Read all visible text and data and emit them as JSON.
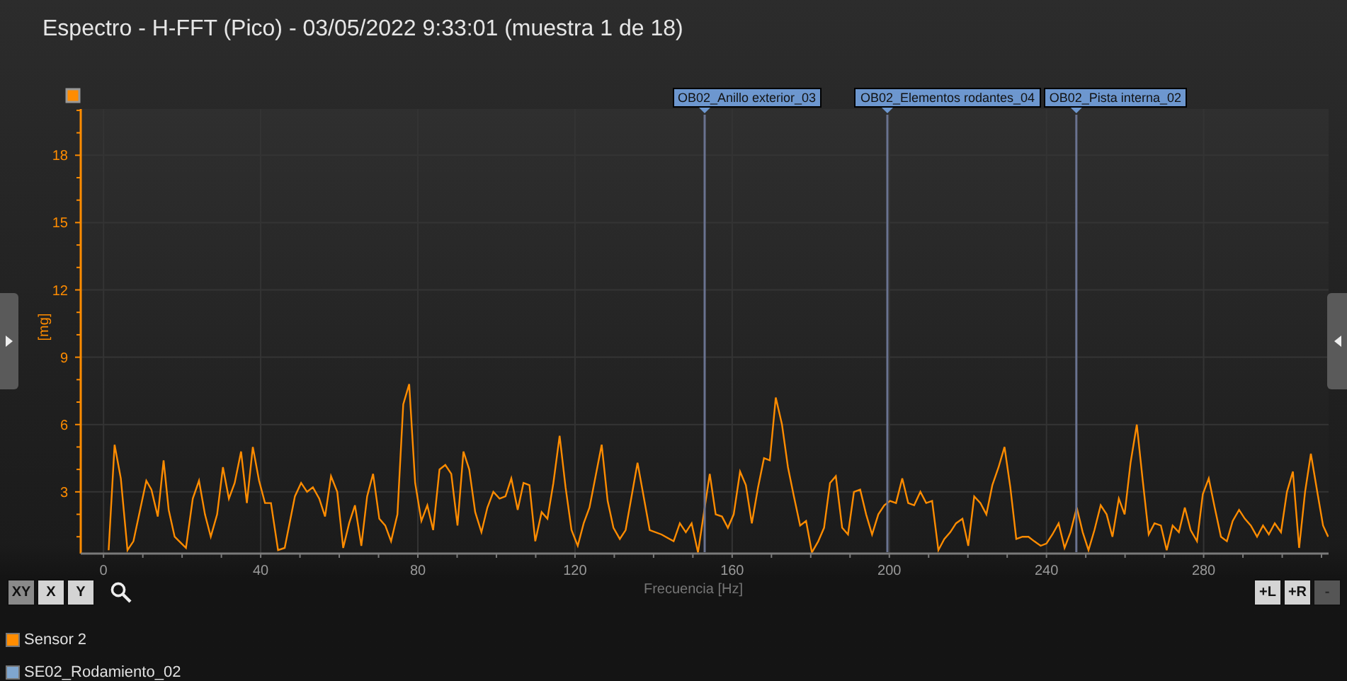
{
  "title": "Espectro - H-FFT (Pico) - 03/05/2022 9:33:01 (muestra 1 de 18)",
  "chart": {
    "chart_data": {
      "type": "line",
      "xlabel": "Frecuencia [Hz]",
      "ylabel": "[mg]",
      "grid": true,
      "xlim": [
        -5.8,
        311.8
      ],
      "ylim": [
        0.25,
        20.06
      ],
      "xticks": [
        0,
        40,
        80,
        120,
        160,
        200,
        240,
        280
      ],
      "yticks": [
        3,
        6,
        9,
        12,
        15,
        18
      ],
      "x": [
        1.3,
        2.8,
        4.4,
        6.1,
        7.6,
        10.9,
        12.2,
        13.8,
        15.3,
        16.6,
        18.1,
        21,
        22.7,
        24.3,
        25.8,
        27.3,
        28.9,
        30.4,
        31.9,
        33.4,
        35,
        36.5,
        38,
        39.6,
        41.1,
        42.6,
        44.4,
        46.1,
        48.7,
        50.3,
        51.8,
        53.3,
        54.9,
        56.4,
        57.9,
        59.5,
        61,
        62.5,
        64,
        65.6,
        67.1,
        68.6,
        70.2,
        71.7,
        73.2,
        74.8,
        76.3,
        77.8,
        79.3,
        80.9,
        82.4,
        83.9,
        85.5,
        87,
        88.5,
        90.1,
        91.6,
        93.1,
        94.6,
        96.2,
        97.7,
        99.2,
        100.8,
        102.3,
        103.8,
        105.4,
        106.9,
        108.4,
        109.9,
        111.5,
        113,
        114.5,
        116.1,
        117.6,
        119.1,
        120.7,
        122.2,
        123.7,
        126.8,
        128.3,
        129.8,
        131.4,
        132.9,
        135.9,
        139,
        142,
        145.1,
        146.7,
        148.2,
        149.7,
        151.3,
        154.3,
        155.8,
        157.4,
        158.9,
        160.4,
        162,
        163.5,
        165,
        166.6,
        168.1,
        169.6,
        171.1,
        172.7,
        174.2,
        175.7,
        177.3,
        178.8,
        180.3,
        181.9,
        183.4,
        184.9,
        186.4,
        188,
        189.5,
        191,
        192.6,
        194.1,
        195.6,
        197.2,
        198.7,
        200.2,
        201.7,
        203.3,
        204.8,
        206.3,
        207.9,
        209.4,
        210.9,
        212.5,
        214,
        215.5,
        217,
        218.6,
        220.1,
        221.6,
        223.2,
        224.7,
        226.2,
        227.8,
        229.3,
        230.8,
        232.3,
        233.9,
        235.4,
        236.9,
        238.5,
        240,
        241.5,
        243.1,
        244.6,
        246.1,
        247.7,
        249.2,
        250.7,
        252.2,
        253.8,
        255.3,
        256.8,
        258.4,
        259.9,
        261.4,
        263,
        264.5,
        266,
        267.5,
        269.1,
        270.6,
        272.1,
        273.7,
        275.2,
        276.7,
        278.3,
        279.8,
        281.3,
        282.8,
        284.4,
        285.9,
        287.4,
        289,
        290.5,
        292,
        293.6,
        295.1,
        296.6,
        298.1,
        299.7,
        301.2,
        302.7,
        304.3,
        305.8,
        307.3,
        308.9,
        310.4,
        311.7
      ],
      "series": [
        {
          "name": "Sensor 2",
          "color": "#ff8c00",
          "values": [
            0.4,
            5.1,
            3.6,
            0.4,
            0.8,
            3.5,
            3.1,
            1.9,
            4.4,
            2.2,
            1.0,
            0.5,
            2.7,
            3.5,
            2.0,
            1.0,
            2.0,
            4.1,
            2.7,
            3.4,
            4.8,
            2.5,
            5.0,
            3.5,
            2.5,
            2.5,
            0.4,
            0.5,
            2.8,
            3.4,
            3.0,
            3.2,
            2.7,
            1.9,
            3.7,
            3.0,
            0.5,
            1.6,
            2.4,
            0.6,
            2.8,
            3.8,
            1.8,
            1.5,
            0.8,
            2.0,
            6.9,
            7.8,
            3.4,
            1.7,
            2.4,
            1.3,
            4.0,
            4.2,
            3.8,
            1.5,
            4.8,
            4.0,
            2.1,
            1.2,
            2.3,
            3.0,
            2.7,
            2.8,
            3.6,
            2.2,
            3.4,
            3.3,
            0.8,
            2.1,
            1.8,
            3.4,
            5.5,
            3.2,
            1.3,
            0.6,
            1.6,
            2.3,
            5.1,
            2.6,
            1.4,
            0.9,
            1.3,
            4.3,
            1.3,
            1.1,
            0.8,
            1.6,
            1.2,
            1.6,
            0.3,
            3.8,
            2.0,
            1.9,
            1.4,
            2.0,
            3.9,
            3.3,
            1.6,
            3.2,
            4.5,
            4.4,
            7.2,
            6.0,
            4.1,
            2.8,
            1.5,
            1.7,
            0.3,
            0.8,
            1.4,
            3.4,
            3.7,
            1.4,
            1.1,
            3.0,
            3.1,
            2.0,
            1.1,
            2.0,
            2.4,
            2.6,
            2.5,
            3.6,
            2.5,
            2.4,
            3.0,
            2.5,
            2.6,
            0.4,
            0.9,
            1.2,
            1.6,
            1.8,
            0.6,
            2.8,
            2.5,
            2.0,
            3.3,
            4.1,
            5.0,
            3.2,
            0.9,
            1.0,
            1.0,
            0.8,
            0.6,
            0.7,
            1.1,
            1.6,
            0.5,
            1.2,
            2.3,
            1.2,
            0.4,
            1.3,
            2.4,
            2.0,
            1.0,
            2.7,
            2.0,
            4.3,
            6.0,
            3.5,
            1.1,
            1.6,
            1.5,
            0.4,
            1.5,
            1.2,
            2.3,
            1.3,
            0.8,
            2.9,
            3.6,
            2.3,
            1.0,
            0.8,
            1.7,
            2.2,
            1.8,
            1.5,
            1.0,
            1.5,
            1.1,
            1.6,
            1.2,
            3.0,
            3.9,
            0.5,
            3.0,
            4.7,
            3.0,
            1.5,
            1.0
          ]
        }
      ],
      "ref_lines": [
        {
          "axis": "x",
          "value": 153,
          "label": "OB02_Anillo exterior_03"
        },
        {
          "axis": "x",
          "value": 199.5,
          "label": "OB02_Elementos rodantes_04"
        },
        {
          "axis": "x",
          "value": 247.6,
          "label": "OB02_Pista interna_02"
        }
      ]
    }
  },
  "zoom_modes": [
    {
      "label": "XY",
      "selected": true
    },
    {
      "label": "X",
      "selected": false
    },
    {
      "label": "Y",
      "selected": false
    }
  ],
  "range_buttons": [
    {
      "label": "+L",
      "disabled": false
    },
    {
      "label": "+R",
      "disabled": false
    },
    {
      "label": "-",
      "disabled": true
    }
  ],
  "legend": [
    {
      "label": "SE02_Rodamiento_02",
      "color": "#7fa6cf"
    }
  ]
}
